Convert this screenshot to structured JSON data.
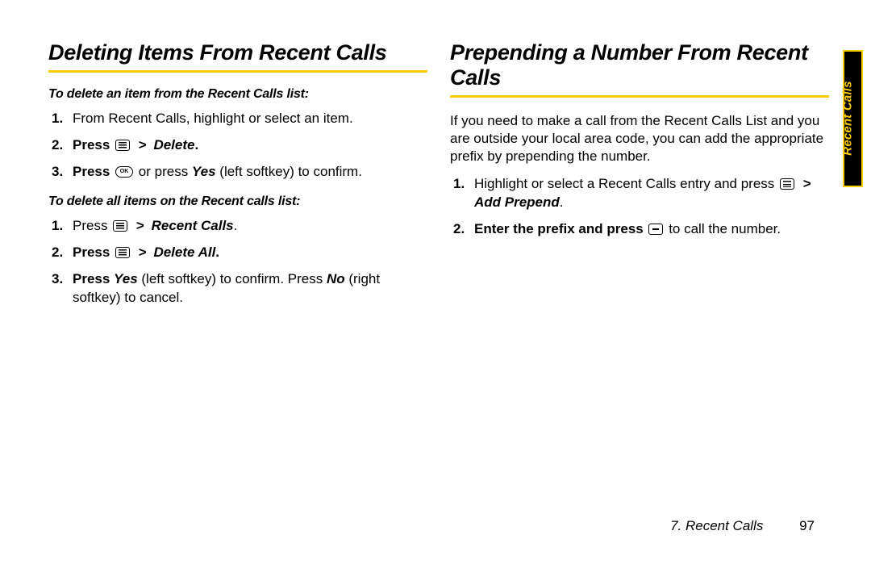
{
  "left": {
    "heading": "Deleting Items From Recent Calls",
    "intro1": "To delete an item from the Recent Calls list:",
    "s1": {
      "a": "From Recent Calls, highlight or select an item.",
      "b_pre": "Press ",
      "b_cmd": "Delete",
      "b_post": ".",
      "c_pre": "Press ",
      "c_mid": " or press ",
      "c_yes": "Yes",
      "c_after": " (left softkey) to confirm."
    },
    "intro2": "To delete all items on the Recent calls list:",
    "s2": {
      "a_pre": "Press ",
      "a_cmd": "Recent Calls",
      "a_post": ".",
      "b_pre": "Press ",
      "b_cmd": "Delete All",
      "b_post": ".",
      "c_pre": "Press ",
      "c_yes": "Yes",
      "c_mid1": " (left softkey) to confirm. Press ",
      "c_no": "No",
      "c_mid2": " (right softkey) to cancel."
    }
  },
  "right": {
    "heading": "Prepending a Number From Recent Calls",
    "para": "If you need to make a call from the Recent Calls List and you are outside your local area code, you can add the appropriate prefix by prepending the number.",
    "s": {
      "a_pre": "Highlight or select a Recent Calls entry and press ",
      "a_cmd": "Add Prepend",
      "a_post": ".",
      "b_pre": "Enter the prefix and press ",
      "b_post": " to call the number."
    }
  },
  "sidetab": "Recent Calls",
  "footer": {
    "chapter": "7. Recent Calls",
    "page": "97"
  },
  "gt": ">"
}
